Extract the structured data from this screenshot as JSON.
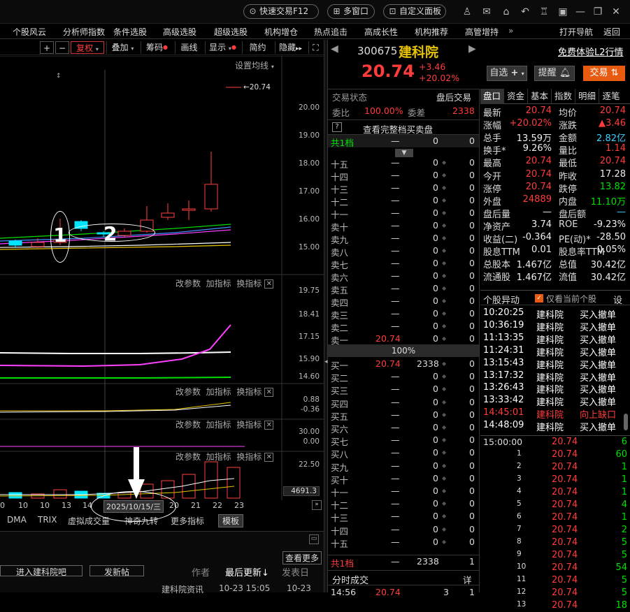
{
  "topbar": {
    "quick_trade": "快速交易F12",
    "multi_window": "多窗口",
    "custom_panel": "自定义面板"
  },
  "menu": [
    "个股风云",
    "分析师指数",
    "条件选股",
    "高级选股",
    "超级选股",
    "机构增仓",
    "热点追击",
    "高成长性",
    "机构推荐",
    "高管增持",
    "»",
    "打开导航",
    "返回"
  ],
  "toolbar": {
    "plus": "+",
    "minus": "−",
    "fq": "复权",
    "overlay": "叠加",
    "chip": "筹码",
    "draw": "画线",
    "display": "显示",
    "simple": "简约",
    "hide": "隐藏"
  },
  "kline": {
    "set_ma": "设置均线",
    "last_price_tag": "20.74",
    "yaxis": [
      "20.00",
      "19.00",
      "18.00",
      "17.00",
      "16.00",
      "15.00"
    ],
    "annot_1": "1",
    "annot_2": "2",
    "candles": [
      {
        "o": 15.1,
        "c": 15.25,
        "h": 15.3,
        "l": 15.0,
        "up": false
      },
      {
        "o": 15.05,
        "c": 15.2,
        "h": 15.35,
        "l": 15.0,
        "up": true
      },
      {
        "o": 15.2,
        "c": 15.3,
        "h": 16.05,
        "l": 15.1,
        "up": true
      },
      {
        "o": 15.7,
        "c": 15.95,
        "h": 16.0,
        "l": 15.6,
        "up": false
      },
      {
        "o": 15.5,
        "c": 15.55,
        "h": 15.6,
        "l": 15.4,
        "up": false
      },
      {
        "o": 15.45,
        "c": 15.6,
        "h": 15.7,
        "l": 15.4,
        "up": true
      },
      {
        "o": 15.6,
        "c": 16.0,
        "h": 16.5,
        "l": 15.55,
        "up": true
      },
      {
        "o": 16.1,
        "c": 16.25,
        "h": 16.6,
        "l": 16.0,
        "up": true
      },
      {
        "o": 16.35,
        "c": 16.4,
        "h": 16.7,
        "l": 16.0,
        "up": true
      },
      {
        "o": 16.4,
        "c": 17.28,
        "h": 18.45,
        "l": 16.3,
        "up": true
      }
    ]
  },
  "panels": {
    "edit_params": "改参数",
    "add_indicator": "加指标",
    "switch_indicator": "换指标",
    "p2_axis": [
      "19.75",
      "18.41",
      "17.15",
      "15.90",
      "14.60"
    ],
    "p3_axis": [
      "0.88",
      "-0.36"
    ],
    "p4_axis": [
      "30.00",
      "0.00"
    ],
    "p5_axis": [
      "22.50"
    ],
    "p5_box": "4691.3"
  },
  "xaxis": {
    "labels": [
      "0",
      "10",
      "10",
      "13",
      "14",
      "21",
      "22",
      "23"
    ],
    "date_box": "2025/10/15/三",
    "num_20": "20"
  },
  "indicator_tabs": [
    "DMA",
    "TRIX",
    "虚拟成交量",
    "神奇九转",
    "更多指标",
    "模板"
  ],
  "forum": {
    "enter": "进入建科院吧",
    "post": "发新帖",
    "author": "作者",
    "last_update": "最后更新",
    "post_date": "发表日",
    "more": "查看更多",
    "news_title": "建科院资讯",
    "news_time": "10-23 15:05",
    "news_date": "10-23"
  },
  "stock": {
    "code": "300675",
    "name": "建科院",
    "l2": "免费体验L2行情",
    "price": "20.74",
    "change": "+3.46",
    "pct": "+20.02%",
    "watch": "自选",
    "alert": "提醒",
    "trade": "交易"
  },
  "orderbook": {
    "status_label": "交易状态",
    "status_value": "盘后交易",
    "ratio_label": "委比",
    "ratio_value": "100.00%",
    "diff_label": "委差",
    "diff_value": "2338",
    "view_full": "查看完整档买卖盘",
    "total_label": "共1档",
    "total_dash": "—",
    "total_v1": "0",
    "total_v2": "0",
    "sell_labels": [
      "十五",
      "十四",
      "十三",
      "十二",
      "十一",
      "卖十",
      "卖九",
      "卖八",
      "卖七",
      "卖六",
      "卖五",
      "卖四",
      "卖三",
      "卖二",
      "卖一"
    ],
    "sell1_price": "20.74",
    "mid": "100%",
    "buy_labels": [
      "买一",
      "买二",
      "买三",
      "买四",
      "买五",
      "买六",
      "买七",
      "买八",
      "买九",
      "买十",
      "十一",
      "十二",
      "十三",
      "十四",
      "十五"
    ],
    "buy1_price": "20.74",
    "buy1_vol": "2338",
    "bottom_label": "共1档",
    "bottom_dash": "—",
    "bottom_vol": "2338",
    "bottom_n": "1",
    "ticks_label": "分时成交",
    "ticks_more": "详",
    "tick_last_time": "14:56",
    "tick_last_price": "20.74",
    "tick_last_vol": "3",
    "tick_last_n": "1",
    "dash": "—",
    "zero": "0"
  },
  "quote_tabs": [
    "盘口",
    "资金",
    "基本",
    "指数",
    "明细",
    "逐笔"
  ],
  "quote": [
    [
      "最新",
      "20.74",
      "red",
      "均价",
      "20.74",
      "red"
    ],
    [
      "涨幅",
      "+20.02%",
      "red",
      "涨跌",
      "▲3.46",
      "red"
    ],
    [
      "总手",
      "13.59万",
      "white",
      "金额",
      "2.82亿",
      "cyan"
    ],
    [
      "换手*",
      "9.26%",
      "white",
      "量比",
      "1.14",
      "red"
    ],
    [
      "最高",
      "20.74",
      "red",
      "最低",
      "20.74",
      "red"
    ],
    [
      "今开",
      "20.74",
      "red",
      "昨收",
      "17.28",
      "white"
    ],
    [
      "涨停",
      "20.74",
      "red",
      "跌停",
      "13.82",
      "green"
    ],
    [
      "外盘",
      "24889",
      "red",
      "内盘",
      "11.10万",
      "green"
    ],
    [
      "盘后量",
      "—",
      "white",
      "盘后额",
      "—",
      "cyan"
    ],
    [
      "净资产",
      "3.74",
      "white",
      "ROE",
      "-9.23%",
      "white"
    ],
    [
      "收益(二)",
      "-0.364",
      "white",
      "PE(动)*",
      "-28.50",
      "white"
    ],
    [
      "股息TTM",
      "0.01",
      "white",
      "股息率TTM",
      "0.05%",
      "white"
    ],
    [
      "总股本",
      "1.467亿",
      "white",
      "总值",
      "30.42亿",
      "white"
    ],
    [
      "流通股",
      "1.467亿",
      "white",
      "流值",
      "30.42亿",
      "white"
    ]
  ],
  "alerts": {
    "title": "个股异动",
    "only_current": "仅看当前个股",
    "settings": "设",
    "rows": [
      [
        "10:20:25",
        "建科院",
        "买入撤单",
        "white"
      ],
      [
        "10:36:19",
        "建科院",
        "买入撤单",
        "white"
      ],
      [
        "11:13:35",
        "建科院",
        "买入撤单",
        "white"
      ],
      [
        "11:24:31",
        "建科院",
        "买入撤单",
        "white"
      ],
      [
        "13:15:43",
        "建科院",
        "买入撤单",
        "white"
      ],
      [
        "13:17:32",
        "建科院",
        "买入撤单",
        "white"
      ],
      [
        "13:26:43",
        "建科院",
        "买入撤单",
        "white"
      ],
      [
        "13:33:42",
        "建科院",
        "买入撤单",
        "white"
      ],
      [
        "14:45:01",
        "建科院",
        "向上缺口",
        "red"
      ],
      [
        "14:48:09",
        "建科院",
        "买入撤单",
        "white"
      ]
    ]
  },
  "ticks": [
    [
      "15:00:00",
      "20.74",
      "6",
      "green"
    ],
    [
      "1",
      "20.74",
      "60",
      "green"
    ],
    [
      "2",
      "20.74",
      "1",
      "green"
    ],
    [
      "3",
      "20.74",
      "1",
      "green"
    ],
    [
      "4",
      "20.74",
      "1",
      "green"
    ],
    [
      "5",
      "20.74",
      "4",
      "green"
    ],
    [
      "6",
      "20.74",
      "1",
      "green"
    ],
    [
      "7",
      "20.74",
      "2",
      "green"
    ],
    [
      "8",
      "20.74",
      "5",
      "green"
    ],
    [
      "9",
      "20.74",
      "5",
      "green"
    ],
    [
      "10",
      "20.74",
      "54",
      "green"
    ],
    [
      "11",
      "20.74",
      "5",
      "green"
    ],
    [
      "12",
      "20.74",
      "5",
      "green"
    ],
    [
      "13",
      "20.74",
      "18",
      "green"
    ]
  ]
}
